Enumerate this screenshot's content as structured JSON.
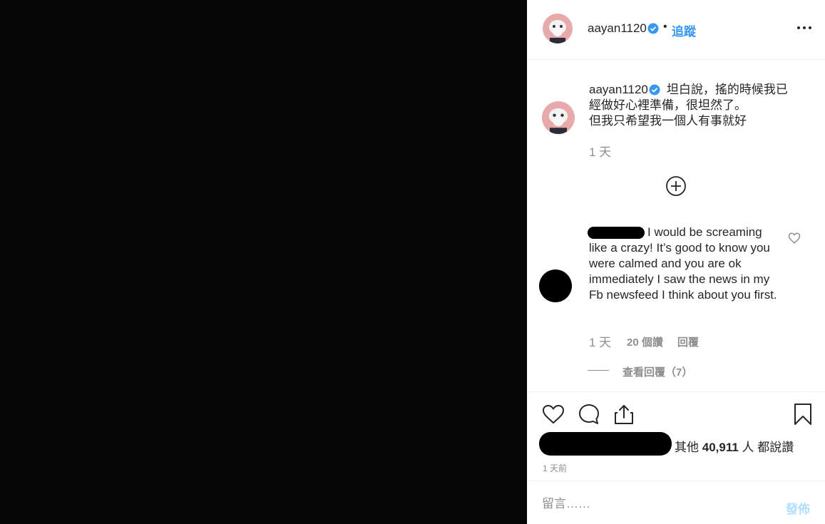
{
  "post": {
    "username": "aayan1120",
    "follow_label": "追蹤",
    "separator": "•"
  },
  "caption": {
    "username": "aayan1120",
    "text_line1": "坦白說，搖的時候我已",
    "text_line2": "經做好心裡準備，很坦然了。",
    "text_line3": "但我只希望我一個人有事就好",
    "time": "1 天"
  },
  "comment": {
    "text": "I would be screaming like a crazy! It’s good to know you were calmed and you are ok immediately I saw the news in my Fb newsfeed I think about you first.",
    "time": "1 天",
    "likes": "20 個讚",
    "reply_label": "回覆",
    "view_replies": "查看回覆（7）"
  },
  "likes": {
    "prefix": "其他",
    "count": "40,911",
    "suffix": "人 都說讚"
  },
  "post_time": "1 天前",
  "comment_box": {
    "placeholder": "留言……",
    "post_label": "發佈"
  },
  "colors": {
    "link_blue": "#3897f0",
    "secondary_text": "#8e8e8e",
    "post_disabled": "#b2dffc",
    "media_bg": "#050505"
  }
}
